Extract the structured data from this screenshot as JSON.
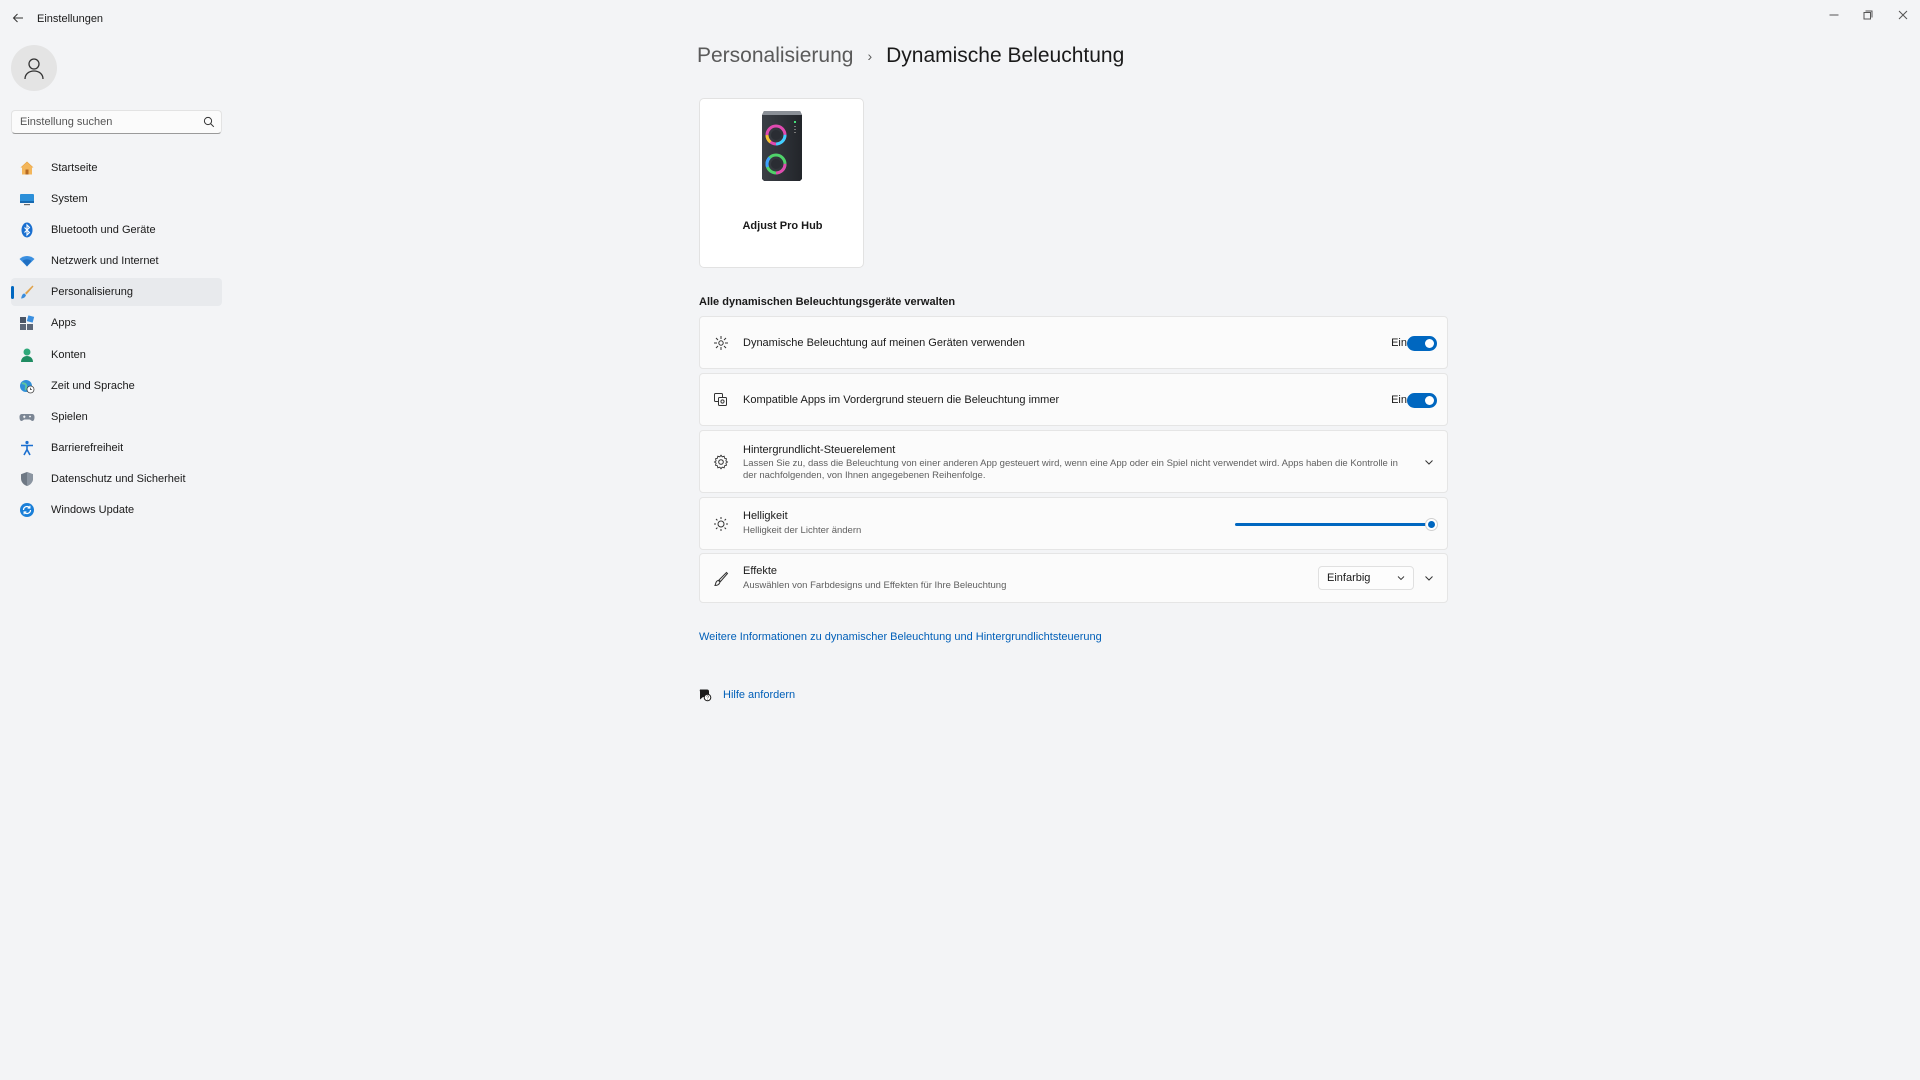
{
  "window": {
    "title": "Einstellungen",
    "controls": [
      "minimize-icon",
      "maximize-icon",
      "close-icon"
    ]
  },
  "sidebar": {
    "search_placeholder": "Einstellung suchen",
    "items": [
      {
        "label": "Startseite",
        "icon": "home-icon"
      },
      {
        "label": "System",
        "icon": "monitor-icon"
      },
      {
        "label": "Bluetooth und Geräte",
        "icon": "bluetooth-icon"
      },
      {
        "label": "Netzwerk und Internet",
        "icon": "wifi-icon"
      },
      {
        "label": "Personalisierung",
        "icon": "brush-icon",
        "active": true
      },
      {
        "label": "Apps",
        "icon": "apps-icon"
      },
      {
        "label": "Konten",
        "icon": "person-icon"
      },
      {
        "label": "Zeit und Sprache",
        "icon": "globe-clock-icon"
      },
      {
        "label": "Spielen",
        "icon": "gamepad-icon"
      },
      {
        "label": "Barrierefreiheit",
        "icon": "accessibility-icon"
      },
      {
        "label": "Datenschutz und Sicherheit",
        "icon": "shield-icon"
      },
      {
        "label": "Windows Update",
        "icon": "update-icon"
      }
    ]
  },
  "breadcrumb": {
    "parent": "Personalisierung",
    "separator": "›",
    "current": "Dynamische Beleuchtung"
  },
  "device": {
    "name": "Adjust Pro Hub"
  },
  "section_title": "Alle dynamischen Beleuchtungsgeräte verwalten",
  "settings": {
    "use_dynamic": {
      "title": "Dynamische Beleuchtung auf meinen Geräten verwenden",
      "state": "Ein"
    },
    "foreground_apps": {
      "title": "Kompatible Apps im Vordergrund steuern die Beleuchtung immer",
      "state": "Ein"
    },
    "background_control": {
      "title": "Hintergrundlicht-Steuerelement",
      "desc": "Lassen Sie zu, dass die Beleuchtung von einer anderen App gesteuert wird, wenn eine App oder ein Spiel nicht verwendet wird. Apps haben die Kontrolle in der nachfolgenden, von Ihnen angegebenen Reihenfolge."
    },
    "brightness": {
      "title": "Helligkeit",
      "desc": "Helligkeit der Lichter ändern",
      "value_percent": 100
    },
    "effects": {
      "title": "Effekte",
      "desc": "Auswählen von Farbdesigns und Effekten für Ihre Beleuchtung",
      "selected": "Einfarbig"
    }
  },
  "links": {
    "more_info": "Weitere Informationen zu dynamischer Beleuchtung und Hintergrundlichtsteuerung",
    "help": "Hilfe anfordern"
  },
  "colors": {
    "accent": "#0067c0",
    "link": "#005fb8",
    "background": "#f3f4f6",
    "card": "#fbfbfb"
  }
}
